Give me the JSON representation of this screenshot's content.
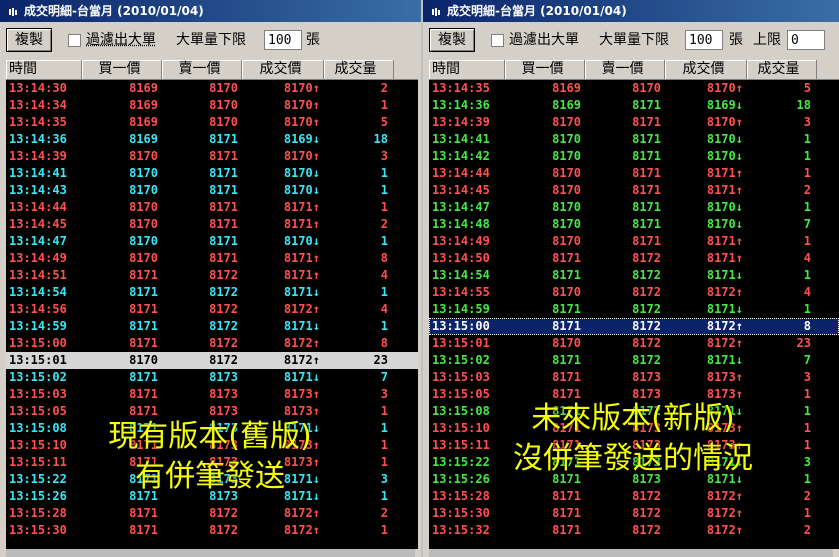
{
  "left": {
    "title": "成交明細-台當月 (2010/01/04)",
    "copy_label": "複製",
    "filter_label": "過濾出大單",
    "threshold_label": "大單量下限",
    "threshold_value": "100",
    "unit_label": "張",
    "columns": [
      "時間",
      "買一價",
      "賣一價",
      "成交價",
      "成交量"
    ],
    "overlay_line1": "現有版本(舊版)",
    "overlay_line2": "有併筆發送",
    "rows": [
      {
        "time": "13:14:30",
        "bid": "8169",
        "ask": "8170",
        "price": "8170",
        "arrow": "↑",
        "vol": "2",
        "color": "red"
      },
      {
        "time": "13:14:34",
        "bid": "8169",
        "ask": "8170",
        "price": "8170",
        "arrow": "↑",
        "vol": "1",
        "color": "red"
      },
      {
        "time": "13:14:35",
        "bid": "8169",
        "ask": "8170",
        "price": "8170",
        "arrow": "↑",
        "vol": "5",
        "color": "red"
      },
      {
        "time": "13:14:36",
        "bid": "8169",
        "ask": "8171",
        "price": "8169",
        "arrow": "↓",
        "vol": "18",
        "color": "cyan"
      },
      {
        "time": "13:14:39",
        "bid": "8170",
        "ask": "8171",
        "price": "8170",
        "arrow": "↑",
        "vol": "3",
        "color": "red"
      },
      {
        "time": "13:14:41",
        "bid": "8170",
        "ask": "8171",
        "price": "8170",
        "arrow": "↓",
        "vol": "1",
        "color": "cyan"
      },
      {
        "time": "13:14:43",
        "bid": "8170",
        "ask": "8171",
        "price": "8170",
        "arrow": "↓",
        "vol": "1",
        "color": "cyan"
      },
      {
        "time": "13:14:44",
        "bid": "8170",
        "ask": "8171",
        "price": "8171",
        "arrow": "↑",
        "vol": "1",
        "color": "red"
      },
      {
        "time": "13:14:45",
        "bid": "8170",
        "ask": "8171",
        "price": "8171",
        "arrow": "↑",
        "vol": "2",
        "color": "red"
      },
      {
        "time": "13:14:47",
        "bid": "8170",
        "ask": "8171",
        "price": "8170",
        "arrow": "↓",
        "vol": "1",
        "color": "cyan"
      },
      {
        "time": "13:14:49",
        "bid": "8170",
        "ask": "8171",
        "price": "8171",
        "arrow": "↑",
        "vol": "8",
        "color": "red"
      },
      {
        "time": "13:14:51",
        "bid": "8171",
        "ask": "8172",
        "price": "8171",
        "arrow": "↑",
        "vol": "4",
        "color": "red"
      },
      {
        "time": "13:14:54",
        "bid": "8171",
        "ask": "8172",
        "price": "8171",
        "arrow": "↓",
        "vol": "1",
        "color": "cyan"
      },
      {
        "time": "13:14:56",
        "bid": "8171",
        "ask": "8172",
        "price": "8172",
        "arrow": "↑",
        "vol": "4",
        "color": "red"
      },
      {
        "time": "13:14:59",
        "bid": "8171",
        "ask": "8172",
        "price": "8171",
        "arrow": "↓",
        "vol": "1",
        "color": "cyan"
      },
      {
        "time": "13:15:00",
        "bid": "8171",
        "ask": "8172",
        "price": "8172",
        "arrow": "↑",
        "vol": "8",
        "color": "red"
      },
      {
        "time": "13:15:01",
        "bid": "8170",
        "ask": "8172",
        "price": "8172",
        "arrow": "↑",
        "vol": "23",
        "color": "red",
        "selected": "gray"
      },
      {
        "time": "13:15:02",
        "bid": "8171",
        "ask": "8173",
        "price": "8171",
        "arrow": "↓",
        "vol": "7",
        "color": "cyan"
      },
      {
        "time": "13:15:03",
        "bid": "8171",
        "ask": "8173",
        "price": "8173",
        "arrow": "↑",
        "vol": "3",
        "color": "red"
      },
      {
        "time": "13:15:05",
        "bid": "8171",
        "ask": "8173",
        "price": "8173",
        "arrow": "↑",
        "vol": "1",
        "color": "red"
      },
      {
        "time": "13:15:08",
        "bid": "8171",
        "ask": "8173",
        "price": "8171",
        "arrow": "↓",
        "vol": "1",
        "color": "cyan"
      },
      {
        "time": "13:15:10",
        "bid": "8171",
        "ask": "8173",
        "price": "8173",
        "arrow": "↑",
        "vol": "1",
        "color": "red"
      },
      {
        "time": "13:15:11",
        "bid": "8171",
        "ask": "8173",
        "price": "8173",
        "arrow": "↑",
        "vol": "1",
        "color": "red"
      },
      {
        "time": "13:15:22",
        "bid": "8171",
        "ask": "8173",
        "price": "8171",
        "arrow": "↓",
        "vol": "3",
        "color": "cyan"
      },
      {
        "time": "13:15:26",
        "bid": "8171",
        "ask": "8173",
        "price": "8171",
        "arrow": "↓",
        "vol": "1",
        "color": "cyan"
      },
      {
        "time": "13:15:28",
        "bid": "8171",
        "ask": "8172",
        "price": "8172",
        "arrow": "↑",
        "vol": "2",
        "color": "red"
      },
      {
        "time": "13:15:30",
        "bid": "8171",
        "ask": "8172",
        "price": "8172",
        "arrow": "↑",
        "vol": "1",
        "color": "red"
      }
    ]
  },
  "right": {
    "title": "成交明細-台當月 (2010/01/04)",
    "copy_label": "複製",
    "filter_label": "過濾出大單",
    "threshold_label": "大單量下限",
    "threshold_value": "100",
    "unit_label": "張",
    "upper_label": "上限",
    "upper_value": "0",
    "columns": [
      "時間",
      "買一價",
      "賣一價",
      "成交價",
      "成交量"
    ],
    "overlay_line1": "未來版本(新版)",
    "overlay_line2": "沒併筆發送的情況",
    "rows": [
      {
        "time": "13:14:35",
        "bid": "8169",
        "ask": "8170",
        "price": "8170",
        "arrow": "↑",
        "vol": "5",
        "color": "red"
      },
      {
        "time": "13:14:36",
        "bid": "8169",
        "ask": "8171",
        "price": "8169",
        "arrow": "↓",
        "vol": "18",
        "color": "green"
      },
      {
        "time": "13:14:39",
        "bid": "8170",
        "ask": "8171",
        "price": "8170",
        "arrow": "↑",
        "vol": "3",
        "color": "red"
      },
      {
        "time": "13:14:41",
        "bid": "8170",
        "ask": "8171",
        "price": "8170",
        "arrow": "↓",
        "vol": "1",
        "color": "green"
      },
      {
        "time": "13:14:42",
        "bid": "8170",
        "ask": "8171",
        "price": "8170",
        "arrow": "↓",
        "vol": "1",
        "color": "green"
      },
      {
        "time": "13:14:44",
        "bid": "8170",
        "ask": "8171",
        "price": "8171",
        "arrow": "↑",
        "vol": "1",
        "color": "red"
      },
      {
        "time": "13:14:45",
        "bid": "8170",
        "ask": "8171",
        "price": "8171",
        "arrow": "↑",
        "vol": "2",
        "color": "red"
      },
      {
        "time": "13:14:47",
        "bid": "8170",
        "ask": "8171",
        "price": "8170",
        "arrow": "↓",
        "vol": "1",
        "color": "green"
      },
      {
        "time": "13:14:48",
        "bid": "8170",
        "ask": "8171",
        "price": "8170",
        "arrow": "↓",
        "vol": "7",
        "color": "green"
      },
      {
        "time": "13:14:49",
        "bid": "8170",
        "ask": "8171",
        "price": "8171",
        "arrow": "↑",
        "vol": "1",
        "color": "red"
      },
      {
        "time": "13:14:50",
        "bid": "8171",
        "ask": "8172",
        "price": "8171",
        "arrow": "↑",
        "vol": "4",
        "color": "red"
      },
      {
        "time": "13:14:54",
        "bid": "8171",
        "ask": "8172",
        "price": "8171",
        "arrow": "↓",
        "vol": "1",
        "color": "green"
      },
      {
        "time": "13:14:55",
        "bid": "8170",
        "ask": "8172",
        "price": "8172",
        "arrow": "↑",
        "vol": "4",
        "color": "red"
      },
      {
        "time": "13:14:59",
        "bid": "8171",
        "ask": "8172",
        "price": "8171",
        "arrow": "↓",
        "vol": "1",
        "color": "green"
      },
      {
        "time": "13:15:00",
        "bid": "8171",
        "ask": "8172",
        "price": "8172",
        "arrow": "↑",
        "vol": "8",
        "color": "red",
        "selected": "blue"
      },
      {
        "time": "13:15:01",
        "bid": "8170",
        "ask": "8172",
        "price": "8172",
        "arrow": "↑",
        "vol": "23",
        "color": "red"
      },
      {
        "time": "13:15:02",
        "bid": "8171",
        "ask": "8172",
        "price": "8171",
        "arrow": "↓",
        "vol": "7",
        "color": "green"
      },
      {
        "time": "13:15:03",
        "bid": "8171",
        "ask": "8173",
        "price": "8173",
        "arrow": "↑",
        "vol": "3",
        "color": "red"
      },
      {
        "time": "13:15:05",
        "bid": "8171",
        "ask": "8173",
        "price": "8173",
        "arrow": "↑",
        "vol": "1",
        "color": "red"
      },
      {
        "time": "13:15:08",
        "bid": "8171",
        "ask": "8172",
        "price": "8171",
        "arrow": "↓",
        "vol": "1",
        "color": "green"
      },
      {
        "time": "13:15:10",
        "bid": "8171",
        "ask": "8173",
        "price": "8173",
        "arrow": "↑",
        "vol": "1",
        "color": "red"
      },
      {
        "time": "13:15:11",
        "bid": "8171",
        "ask": "8173",
        "price": "8173",
        "arrow": "↑",
        "vol": "1",
        "color": "red"
      },
      {
        "time": "13:15:22",
        "bid": "8171",
        "ask": "8173",
        "price": "8171",
        "arrow": "↓",
        "vol": "3",
        "color": "green"
      },
      {
        "time": "13:15:26",
        "bid": "8171",
        "ask": "8173",
        "price": "8171",
        "arrow": "↓",
        "vol": "1",
        "color": "green"
      },
      {
        "time": "13:15:28",
        "bid": "8171",
        "ask": "8172",
        "price": "8172",
        "arrow": "↑",
        "vol": "2",
        "color": "red"
      },
      {
        "time": "13:15:30",
        "bid": "8171",
        "ask": "8172",
        "price": "8172",
        "arrow": "↑",
        "vol": "1",
        "color": "red"
      },
      {
        "time": "13:15:32",
        "bid": "8171",
        "ask": "8172",
        "price": "8172",
        "arrow": "↑",
        "vol": "2",
        "color": "red"
      }
    ]
  }
}
